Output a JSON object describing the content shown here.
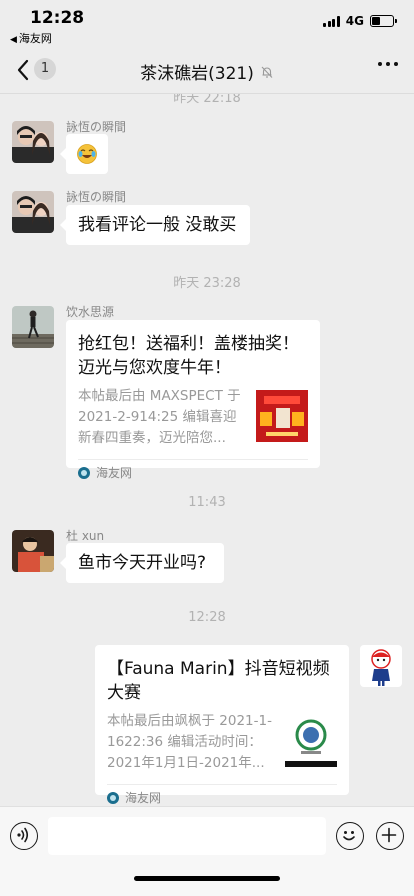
{
  "status_bar": {
    "time": "12:28",
    "back_app": "海友网",
    "network": "4G"
  },
  "nav": {
    "back_count": "1",
    "title": "茶沫礁岩(321)"
  },
  "messages": {
    "time_top": "昨天 22:18",
    "m1_sender": "詠恆の瞬間",
    "m2_sender": "詠恆の瞬間",
    "m2_text": "我看评论一般 没敢买",
    "time_2": "昨天 23:28",
    "m3_sender": "饮水思源",
    "m3_title": "抢红包！送福利！盖楼抽奖！迈光与您欢度牛年！",
    "m3_desc": "本帖最后由 MAXSPECT 于 2021-2-914:25 编辑喜迎新春四重奏，迈光陪您...",
    "m3_source": "海友网",
    "time_3": "11:43",
    "m4_sender": "杜 xun",
    "m4_text": "鱼市今天开业吗?",
    "time_4": "12:28",
    "m5_title": "【Fauna Marin】抖音短视频大赛",
    "m5_desc": "本帖最后由飒枫于 2021-1-1622:36 编辑活动时间：2021年1月1日-2021年...",
    "m5_source": "海友网"
  },
  "icons": {
    "voice": "voice-icon",
    "emoji": "emoji-icon",
    "plus": "plus-icon",
    "mute": "mute-bell-icon",
    "more": "more-dots-icon"
  },
  "input": {
    "value": ""
  }
}
